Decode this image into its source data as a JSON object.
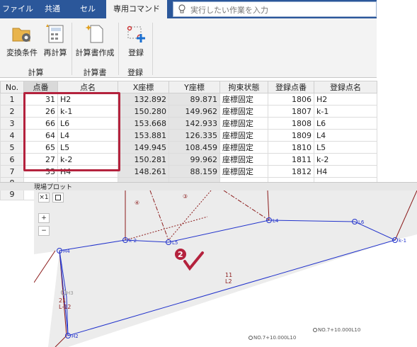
{
  "ribbon_tabs": [
    "ファイル",
    "共通",
    "セル",
    "専用コマンド"
  ],
  "search_placeholder": "実行したい作業を入力",
  "ribbon_buttons": {
    "convert": "変換条件",
    "recalc": "再計算",
    "report": "計算書作成",
    "register": "登録"
  },
  "ribbon_groups": [
    "計算",
    "計算書",
    "登録"
  ],
  "table": {
    "headers": [
      "No.",
      "点番",
      "点名",
      "X座標",
      "Y座標",
      "拘束状態",
      "登録点番",
      "登録点名"
    ],
    "rows": [
      [
        "1",
        "31",
        "H2",
        "132.892",
        "89.871",
        "座標固定",
        "1806",
        "H2"
      ],
      [
        "2",
        "26",
        "k-1",
        "150.280",
        "149.962",
        "座標固定",
        "1807",
        "k-1"
      ],
      [
        "3",
        "66",
        "L6",
        "153.668",
        "142.933",
        "座標固定",
        "1808",
        "L6"
      ],
      [
        "4",
        "64",
        "L4",
        "153.881",
        "126.335",
        "座標固定",
        "1809",
        "L4"
      ],
      [
        "5",
        "65",
        "L5",
        "149.945",
        "108.459",
        "座標固定",
        "1810",
        "L5"
      ],
      [
        "6",
        "27",
        "k-2",
        "150.281",
        "99.962",
        "座標固定",
        "1811",
        "k-2"
      ],
      [
        "7",
        "33",
        "H4",
        "148.261",
        "88.159",
        "座標固定",
        "1812",
        "H4"
      ],
      [
        "8",
        "",
        "",
        "",
        "",
        "",
        "",
        ""
      ],
      [
        "9",
        "",
        "",
        "",
        "",
        "",
        "",
        ""
      ]
    ]
  },
  "plot": {
    "title": "現場プロット",
    "scale_label": "×1",
    "zoom_in": "+",
    "zoom_out": "−",
    "circled_4": "④",
    "circled_3": "③",
    "step_badge": "2",
    "points": {
      "H4": "H4",
      "k2": "k-2",
      "L5": "L5",
      "L4": "L4",
      "L6": "L6",
      "k1": "k-1",
      "H2": "H2",
      "H3": "H3"
    },
    "label_11": "11",
    "label_L2": "L2",
    "label_21": "21",
    "label_L12": "L-12",
    "foot_1": "NO.7+10.000L10",
    "foot_2": "NO.7+10.000L10"
  },
  "colors": {
    "ribbon_blue": "#2b579a",
    "highlight_red": "#b4223d",
    "plot_line_blue": "#2233cc",
    "plot_line_red": "#8b1a1a"
  }
}
